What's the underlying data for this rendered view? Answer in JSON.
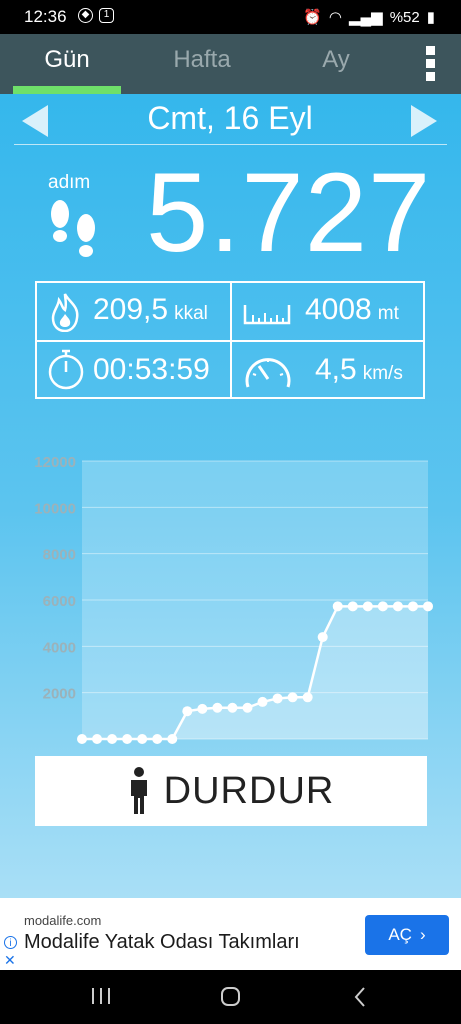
{
  "status_bar": {
    "time": "12:36",
    "battery": "%52"
  },
  "tabs": [
    {
      "label": "Gün",
      "active": true
    },
    {
      "label": "Hafta"
    },
    {
      "label": "Ay"
    }
  ],
  "date": "Cmt, 16 Eyl",
  "steps": {
    "label": "adım",
    "value": "5.727"
  },
  "stats": {
    "calories": {
      "value": "209,5",
      "unit": "kkal"
    },
    "distance": {
      "value": "4008",
      "unit": "mt"
    },
    "duration": {
      "value": "00:53:59"
    },
    "speed": {
      "value": "4,5",
      "unit": "km/s"
    }
  },
  "chart_data": {
    "type": "line",
    "x": [
      1,
      2,
      3,
      4,
      5,
      6,
      7,
      8,
      9,
      10,
      11,
      12,
      13,
      14,
      15,
      16,
      17,
      18,
      19,
      20,
      21,
      22,
      23,
      24
    ],
    "values": [
      0,
      0,
      0,
      0,
      0,
      0,
      0,
      1200,
      1300,
      1350,
      1350,
      1350,
      1600,
      1750,
      1800,
      1800,
      4400,
      5727,
      5727,
      5727,
      5727,
      5727,
      5727,
      5727
    ],
    "ylim": [
      0,
      12000
    ],
    "y_ticks": [
      "12000",
      "10000",
      "8000",
      "6000",
      "4000",
      "2000"
    ],
    "x_ticks": [
      "2",
      "4",
      "6",
      "8",
      "10",
      "12",
      "14",
      "16",
      "18",
      "20",
      "22",
      "24"
    ],
    "grid": true
  },
  "stop_button": {
    "label": "DURDUR"
  },
  "ad": {
    "domain": "modalife.com",
    "title": "Modalife Yatak Odası Takımları",
    "cta": "AÇ"
  },
  "colors": {
    "tab_indicator": "#6fe06a",
    "tabbar": "#3d555c",
    "ad_cta": "#1a73e8"
  }
}
